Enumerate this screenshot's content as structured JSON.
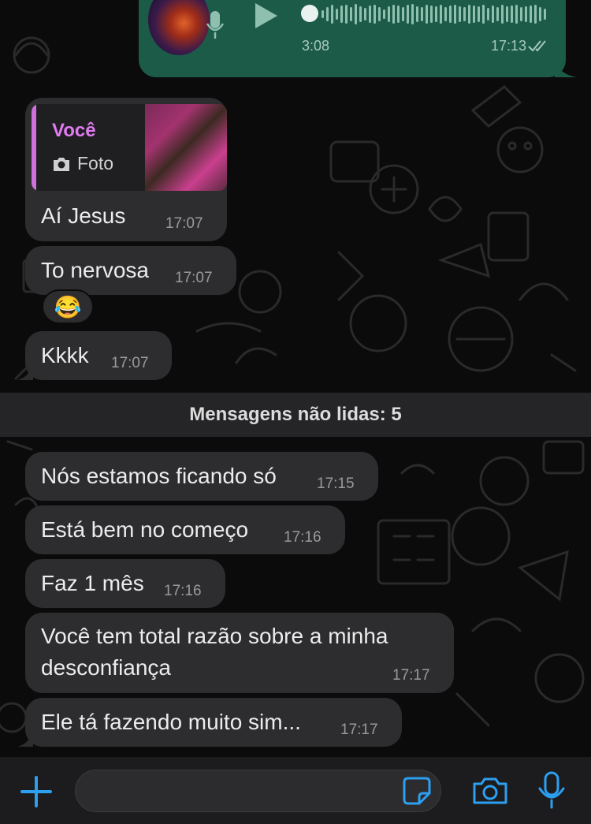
{
  "voice_message": {
    "duration": "3:08",
    "time": "17:13",
    "colors": {
      "bubble": "#1d5b49"
    }
  },
  "messages": [
    {
      "type": "reply",
      "reply_sender": "Você",
      "reply_kind": "Foto",
      "text": "Aí Jesus",
      "time": "17:07"
    },
    {
      "type": "text",
      "text": "To nervosa",
      "time": "17:07",
      "reaction": "😂"
    },
    {
      "type": "text",
      "text": "Kkkk",
      "time": "17:07"
    },
    {
      "type": "text",
      "text": "Nós estamos ficando só",
      "time": "17:15"
    },
    {
      "type": "text",
      "text": "Está bem no começo",
      "time": "17:16"
    },
    {
      "type": "text",
      "text": "Faz 1 mês",
      "time": "17:16"
    },
    {
      "type": "text",
      "text_line1": "Você tem total razão sobre a minha",
      "text_line2": "desconfiança",
      "time": "17:17"
    },
    {
      "type": "text",
      "text": "Ele tá fazendo muito sim...",
      "time": "17:17"
    }
  ],
  "unread_divider": "Mensagens não lidas: 5",
  "input_bar": {
    "placeholder": "",
    "icons": [
      "plus-icon",
      "sticker-icon",
      "camera-icon",
      "microphone-icon"
    ]
  },
  "colors": {
    "accent": "#2d9ff0",
    "incoming_bubble": "#2d2d2f",
    "reply_name": "#e07bf0"
  }
}
